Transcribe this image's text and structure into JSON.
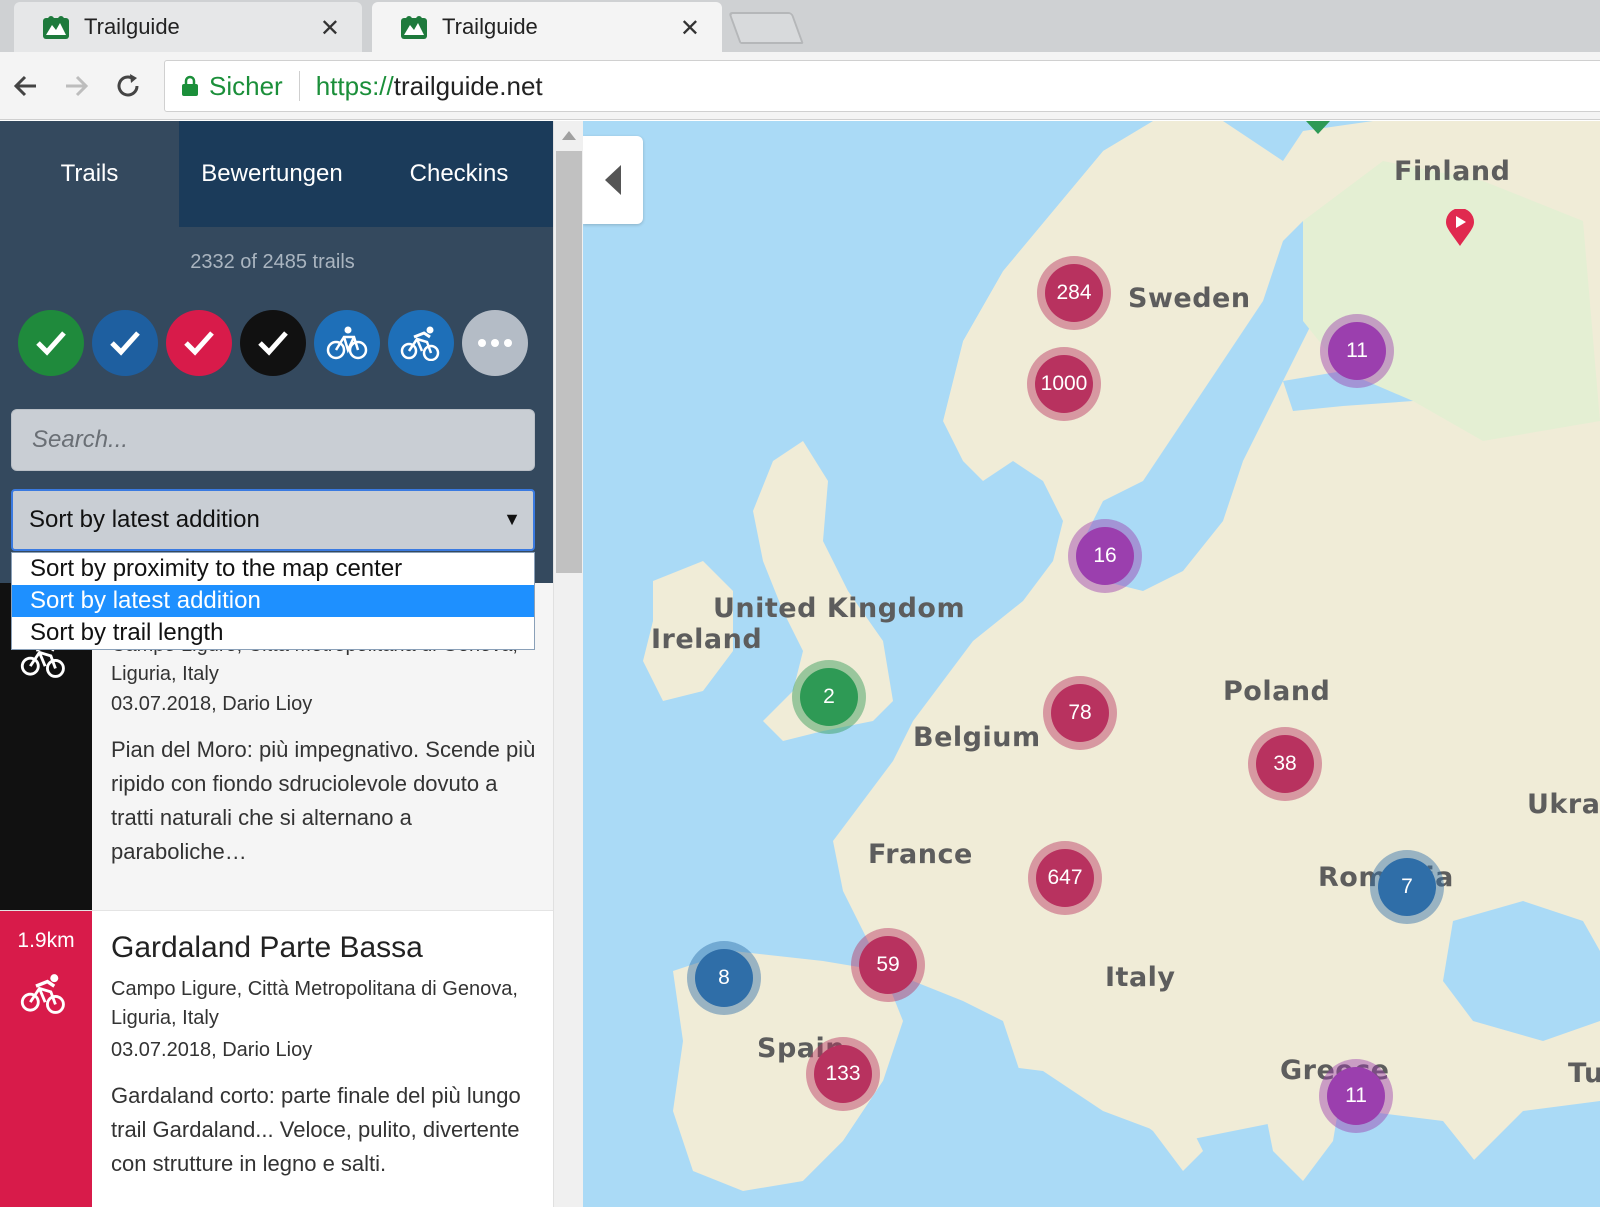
{
  "browser": {
    "tabs": [
      {
        "title": "Trailguide",
        "active": false
      },
      {
        "title": "Trailguide",
        "active": true
      }
    ],
    "secure_label": "Sicher",
    "url_scheme": "https://",
    "url_host": "trailguide.net"
  },
  "sidebar": {
    "tabs": [
      "Trails",
      "Bewertungen",
      "Checkins"
    ],
    "trail_count": "2332 of 2485 trails",
    "filters": [
      {
        "icon": "check-icon",
        "color": "#1f8a3c"
      },
      {
        "icon": "check-icon",
        "color": "#1e5fa0"
      },
      {
        "icon": "check-icon",
        "color": "#d81b4a"
      },
      {
        "icon": "check-icon",
        "color": "#111111"
      },
      {
        "icon": "bike-icon",
        "color": "#1e6fb8"
      },
      {
        "icon": "downhill-bike-icon",
        "color": "#1e6fb8"
      },
      {
        "icon": "more-icon",
        "color": "#b4bcc6"
      }
    ],
    "search_placeholder": "Search...",
    "sort": {
      "selected": "Sort by latest addition",
      "options": [
        "Sort by proximity to the map center",
        "Sort by latest addition",
        "Sort by trail length"
      ]
    },
    "trails": [
      {
        "location": "Campo Ligure, Città Metropolitana di Genova, Liguria, Italy",
        "meta": "03.07.2018, Dario Lioy",
        "description": "Pian del Moro: più impegnativo. Scende più ripido con fiondo sdruciolevole dovuto a tratti naturali che si alternano a paraboliche…",
        "difficulty_color": "#111111"
      },
      {
        "distance": "1.9km",
        "title": "Gardaland Parte Bassa",
        "location": "Campo Ligure, Città Metropolitana di Genova, Liguria, Italy",
        "meta": "03.07.2018, Dario Lioy",
        "description": "Gardaland corto: parte finale del più lungo trail Gardaland... Veloce, pulito, divertente con strutture in legno e salti.",
        "difficulty_color": "#d81b4a"
      }
    ]
  },
  "map": {
    "countries": [
      "Finland",
      "Sweden",
      "United Kingdom",
      "Ireland",
      "Poland",
      "Belgium",
      "Ukrai",
      "France",
      "Romania",
      "Italy",
      "Spain",
      "Greece",
      "Tu"
    ],
    "clusters": [
      "284",
      "11",
      "1000",
      "16",
      "2",
      "78",
      "38",
      "647",
      "7",
      "59",
      "8",
      "133",
      "11"
    ],
    "colors": {
      "red": "#b8325f",
      "purple": "#9b3fae",
      "green": "#2e9a55",
      "blue": "#2f6ea8"
    }
  }
}
